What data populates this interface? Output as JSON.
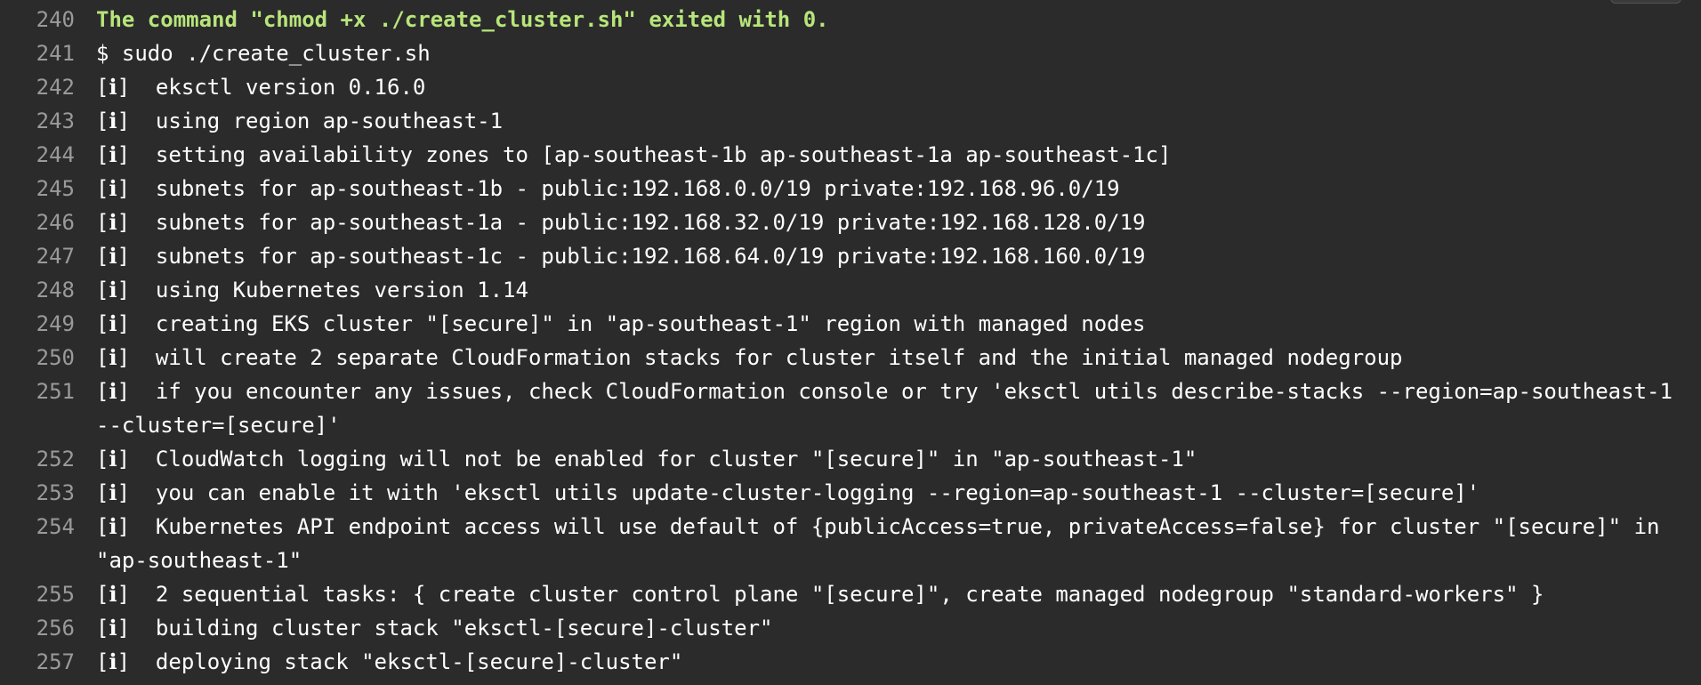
{
  "colors": {
    "background": "#2b2b2b",
    "text": "#ffffff",
    "line_number": "#9a9a9a",
    "success_text": "#b7e57a"
  },
  "log": {
    "lines": [
      {
        "number": "240",
        "text": "The command \"chmod +x ./create_cluster.sh\" exited with 0.",
        "color": "#b7e57a",
        "bold": true
      },
      {
        "number": "241",
        "text": "$ sudo ./create_cluster.sh"
      },
      {
        "number": "242",
        "text": "[ℹ]  eksctl version 0.16.0"
      },
      {
        "number": "243",
        "text": "[ℹ]  using region ap-southeast-1"
      },
      {
        "number": "244",
        "text": "[ℹ]  setting availability zones to [ap-southeast-1b ap-southeast-1a ap-southeast-1c]"
      },
      {
        "number": "245",
        "text": "[ℹ]  subnets for ap-southeast-1b - public:192.168.0.0/19 private:192.168.96.0/19"
      },
      {
        "number": "246",
        "text": "[ℹ]  subnets for ap-southeast-1a - public:192.168.32.0/19 private:192.168.128.0/19"
      },
      {
        "number": "247",
        "text": "[ℹ]  subnets for ap-southeast-1c - public:192.168.64.0/19 private:192.168.160.0/19"
      },
      {
        "number": "248",
        "text": "[ℹ]  using Kubernetes version 1.14"
      },
      {
        "number": "249",
        "text": "[ℹ]  creating EKS cluster \"[secure]\" in \"ap-southeast-1\" region with managed nodes"
      },
      {
        "number": "250",
        "text": "[ℹ]  will create 2 separate CloudFormation stacks for cluster itself and the initial managed nodegroup"
      },
      {
        "number": "251",
        "text": "[ℹ]  if you encounter any issues, check CloudFormation console or try 'eksctl utils describe-stacks --region=ap-southeast-1 --cluster=[secure]'"
      },
      {
        "number": "252",
        "text": "[ℹ]  CloudWatch logging will not be enabled for cluster \"[secure]\" in \"ap-southeast-1\""
      },
      {
        "number": "253",
        "text": "[ℹ]  you can enable it with 'eksctl utils update-cluster-logging --region=ap-southeast-1 --cluster=[secure]'"
      },
      {
        "number": "254",
        "text": "[ℹ]  Kubernetes API endpoint access will use default of {publicAccess=true, privateAccess=false} for cluster \"[secure]\" in \"ap-southeast-1\""
      },
      {
        "number": "255",
        "text": "[ℹ]  2 sequential tasks: { create cluster control plane \"[secure]\", create managed nodegroup \"standard-workers\" }"
      },
      {
        "number": "256",
        "text": "[ℹ]  building cluster stack \"eksctl-[secure]-cluster\""
      },
      {
        "number": "257",
        "text": "[ℹ]  deploying stack \"eksctl-[secure]-cluster\""
      }
    ]
  }
}
